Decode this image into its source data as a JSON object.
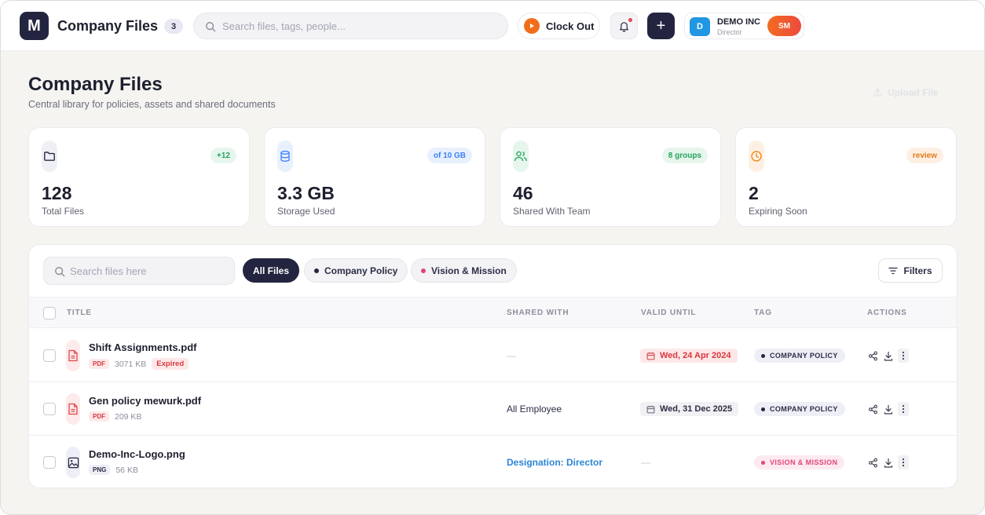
{
  "topbar": {
    "logo_letter": "M",
    "app_title": "Company Files",
    "count": "3",
    "search_placeholder": "Search files, tags, people...",
    "clock_label": "Clock Out",
    "plus_label": "+",
    "company": {
      "initial": "D",
      "name": "DEMO INC",
      "role": "Director"
    },
    "user_initials": "SM"
  },
  "header": {
    "title": "Company Files",
    "subtitle": "Central library for policies, assets and shared documents",
    "upload_label": "Upload File"
  },
  "stats": [
    {
      "icon": "folder-icon",
      "badge": "+12",
      "value": "128",
      "label": "Total Files",
      "color": "#2b2d45"
    },
    {
      "icon": "database-icon",
      "badge": "of 10 GB",
      "value": "3.3 GB",
      "label": "Storage Used",
      "color": "#3b82f6"
    },
    {
      "icon": "users-icon",
      "badge": "8 groups",
      "value": "46",
      "label": "Shared With Team",
      "color": "#22a35a"
    },
    {
      "icon": "clock-icon",
      "badge": "review",
      "value": "2",
      "label": "Expiring Soon",
      "color": "#f08a1c"
    }
  ],
  "toolbar": {
    "search_placeholder": "Search files here",
    "chips": [
      "All Files",
      "Company Policy",
      "Vision & Mission"
    ],
    "filters_label": "Filters"
  },
  "table": {
    "headers": [
      "TITLE",
      "SHARED WITH",
      "VALID UNTIL",
      "TAG",
      "ACTIONS"
    ],
    "rows": [
      {
        "name": "Shift Assignments.pdf",
        "ext": "PDF",
        "size": "3071 KB",
        "status": "Expired",
        "shared": "—",
        "valid_until": "Wed, 24 Apr 2024",
        "tag": "COMPANY POLICY"
      },
      {
        "name": "Gen policy mewurk.pdf",
        "ext": "PDF",
        "size": "209 KB",
        "shared": "All Employee",
        "valid_until": "Wed, 31 Dec 2025",
        "tag": "COMPANY POLICY"
      },
      {
        "name": "Demo-Inc-Logo.png",
        "ext": "PNG",
        "size": "56 KB",
        "shared": "Designation: Director",
        "valid_until": "—",
        "tag": "VISION & MISSION"
      }
    ]
  },
  "colors": {
    "brand": "#232540",
    "accent_orange": "#f26d1b",
    "danger": "#d8383f",
    "link": "#2b86d6",
    "vision_pink": "#e0457a"
  }
}
